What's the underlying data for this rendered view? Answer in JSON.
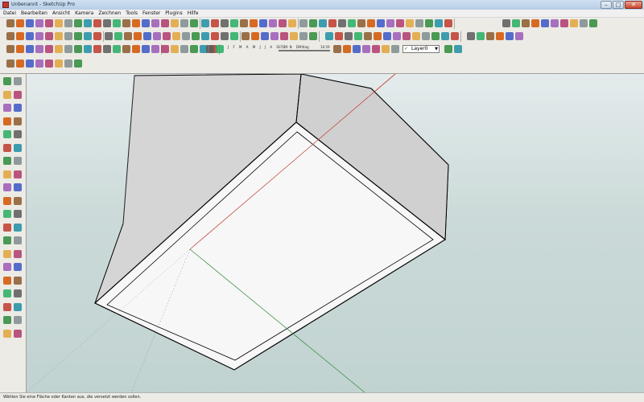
{
  "window": {
    "title": "Unbenannt - SketchUp Pro",
    "controls": [
      "minimize-icon",
      "maximize-icon",
      "close-icon"
    ]
  },
  "menu": [
    "Datei",
    "Bearbeiten",
    "Ansicht",
    "Kamera",
    "Zeichnen",
    "Tools",
    "Fenster",
    "Plugins",
    "Hilfe"
  ],
  "shadow_settings": {
    "months": "J F M A M J J A S O N D",
    "time_start": "07:29",
    "noon_label": "Mittag",
    "time_end": "16:59"
  },
  "layers": {
    "current": "Layer0"
  },
  "status": {
    "text": "Wählen Sie eine Fläche oder Kanten aus, die versetzt werden sollen."
  },
  "colors": {
    "sky": "#e4ebec",
    "ground": "#c1d3d1",
    "axis_red": "#c0392b",
    "axis_green": "#2e8b3a",
    "axis_blue": "#3a57c4",
    "box_side": "#d3d3d3",
    "box_face": "#f7f7f7"
  }
}
